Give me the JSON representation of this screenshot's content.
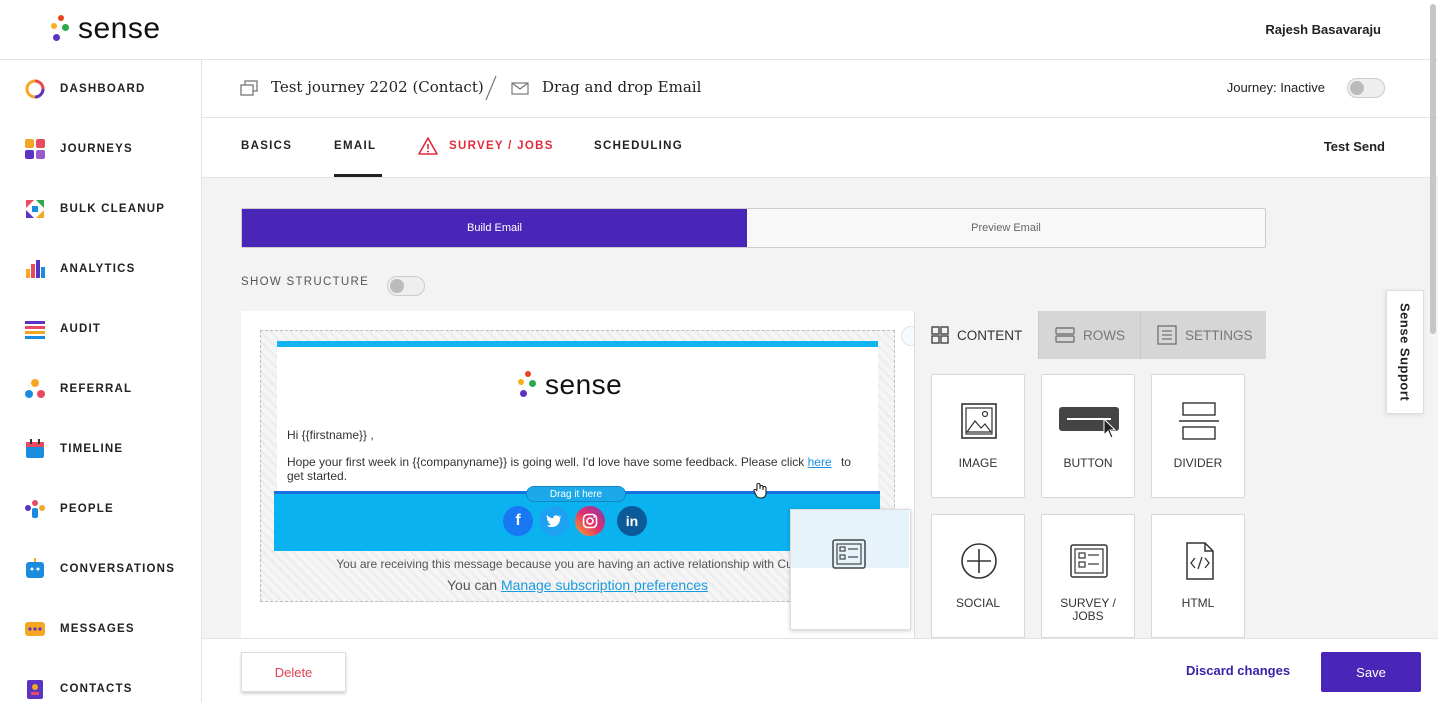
{
  "app": {
    "logo_text": "sense",
    "user_name": "Rajesh Basavaraju"
  },
  "sidebar": {
    "items": [
      {
        "label": "DASHBOARD",
        "icon": "dashboard-icon"
      },
      {
        "label": "JOURNEYS",
        "icon": "journeys-icon"
      },
      {
        "label": "BULK CLEANUP",
        "icon": "bulk-cleanup-icon"
      },
      {
        "label": "ANALYTICS",
        "icon": "analytics-icon"
      },
      {
        "label": "AUDIT",
        "icon": "audit-icon"
      },
      {
        "label": "REFERRAL",
        "icon": "referral-icon"
      },
      {
        "label": "TIMELINE",
        "icon": "timeline-icon"
      },
      {
        "label": "PEOPLE",
        "icon": "people-icon"
      },
      {
        "label": "CONVERSATIONS",
        "icon": "conversations-icon"
      },
      {
        "label": "MESSAGES",
        "icon": "messages-icon"
      },
      {
        "label": "CONTACTS",
        "icon": "contacts-icon"
      }
    ]
  },
  "header": {
    "journey_name": "Test journey 2202 (Contact)",
    "email_name": "Drag and drop Email",
    "journey_status": "Journey: Inactive",
    "journey_active": false
  },
  "tabs": {
    "items": [
      "BASICS",
      "EMAIL",
      "SURVEY / JOBS",
      "SCHEDULING"
    ],
    "active": "EMAIL",
    "test_send": "Test Send"
  },
  "builder": {
    "build_label": "Build Email",
    "preview_label": "Preview Email",
    "show_structure": "SHOW STRUCTURE",
    "show_structure_on": false
  },
  "email": {
    "logo_text": "sense",
    "greeting": "Hi {{firstname}}  ,",
    "body_before": "Hope your first week in {{companyname}}  is going well. I'd love have some feedback. Please click",
    "link_text": "here",
    "body_after": " to",
    "body_line2": "get started.",
    "drag_hint": "Drag it here",
    "social": [
      "f",
      "t",
      "ig",
      "in"
    ],
    "footer_line1": "You are receiving this message because you are having an active relationship with Custom",
    "footer_line2_prefix": "You can ",
    "footer_link": "Manage subscription preferences"
  },
  "panel": {
    "tabs": [
      "CONTENT",
      "ROWS",
      "SETTINGS"
    ],
    "active_tab": "CONTENT",
    "tiles": [
      {
        "label": "IMAGE",
        "icon": "image-icon"
      },
      {
        "label": "BUTTON",
        "icon": "button-icon"
      },
      {
        "label": "DIVIDER",
        "icon": "divider-icon"
      },
      {
        "label": "SOCIAL",
        "icon": "social-icon"
      },
      {
        "label": "SURVEY / JOBS",
        "icon": "survey-jobs-icon"
      },
      {
        "label": "HTML",
        "icon": "html-icon"
      }
    ]
  },
  "support": {
    "label": "Sense Support"
  },
  "footer": {
    "delete": "Delete",
    "discard": "Discard changes",
    "save": "Save"
  },
  "colors": {
    "primary": "#4a26b8",
    "email_accent": "#14b4f0",
    "warning": "#e02b3c"
  }
}
